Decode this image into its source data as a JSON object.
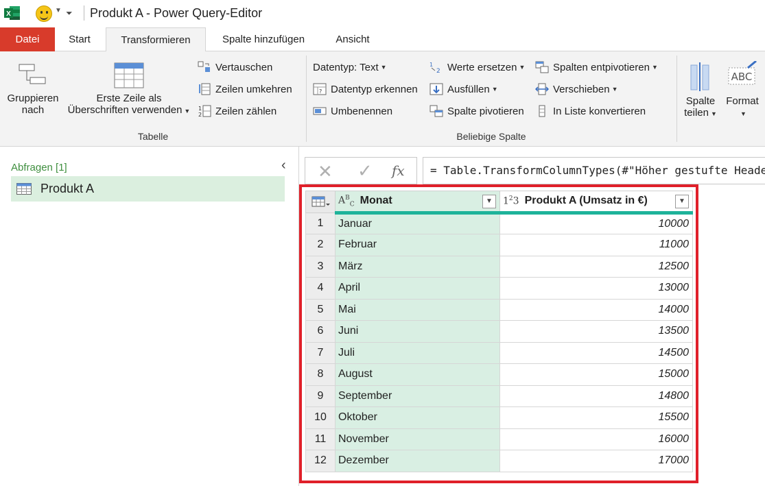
{
  "window": {
    "title": "Produkt A - Power Query-Editor"
  },
  "tabs": [
    "Datei",
    "Start",
    "Transformieren",
    "Spalte hinzufügen",
    "Ansicht"
  ],
  "ribbon": {
    "group_by_line1": "Gruppieren",
    "group_by_line2": "nach",
    "first_row_line1": "Erste Zeile als",
    "first_row_line2": "Überschriften verwenden",
    "transpose": "Vertauschen",
    "reverse_rows": "Zeilen umkehren",
    "count_rows": "Zeilen zählen",
    "table_group": "Tabelle",
    "datatype": "Datentyp: Text",
    "detect_type": "Datentyp erkennen",
    "rename": "Umbenennen",
    "replace_values": "Werte ersetzen",
    "fill": "Ausfüllen",
    "pivot": "Spalte pivotieren",
    "unpivot": "Spalten entpivotieren",
    "move": "Verschieben",
    "to_list": "In Liste konvertieren",
    "any_column_group": "Beliebige Spalte",
    "split_line1": "Spalte",
    "split_line2": "teilen",
    "format": "Format"
  },
  "queries": {
    "label": "Abfragen [1]",
    "items": [
      "Produkt A"
    ]
  },
  "formula": "= Table.TransformColumnTypes(#\"Höher gestufte Headers\"",
  "table": {
    "columns": [
      "Monat",
      "Produkt A (Umsatz in €)"
    ],
    "rows": [
      {
        "n": "1",
        "monat": "Januar",
        "value": "10000"
      },
      {
        "n": "2",
        "monat": "Februar",
        "value": "11000"
      },
      {
        "n": "3",
        "monat": "März",
        "value": "12500"
      },
      {
        "n": "4",
        "monat": "April",
        "value": "13000"
      },
      {
        "n": "5",
        "monat": "Mai",
        "value": "14000"
      },
      {
        "n": "6",
        "monat": "Juni",
        "value": "13500"
      },
      {
        "n": "7",
        "monat": "Juli",
        "value": "14500"
      },
      {
        "n": "8",
        "monat": "August",
        "value": "15000"
      },
      {
        "n": "9",
        "monat": "September",
        "value": "14800"
      },
      {
        "n": "10",
        "monat": "Oktober",
        "value": "15500"
      },
      {
        "n": "11",
        "monat": "November",
        "value": "16000"
      },
      {
        "n": "12",
        "monat": "Dezember",
        "value": "17000"
      }
    ]
  },
  "colors": {
    "file_tab": "#d83b2b",
    "highlight_border": "#e0202a",
    "column_accent": "#1eb39a",
    "selected_column": "#d9efe3"
  }
}
